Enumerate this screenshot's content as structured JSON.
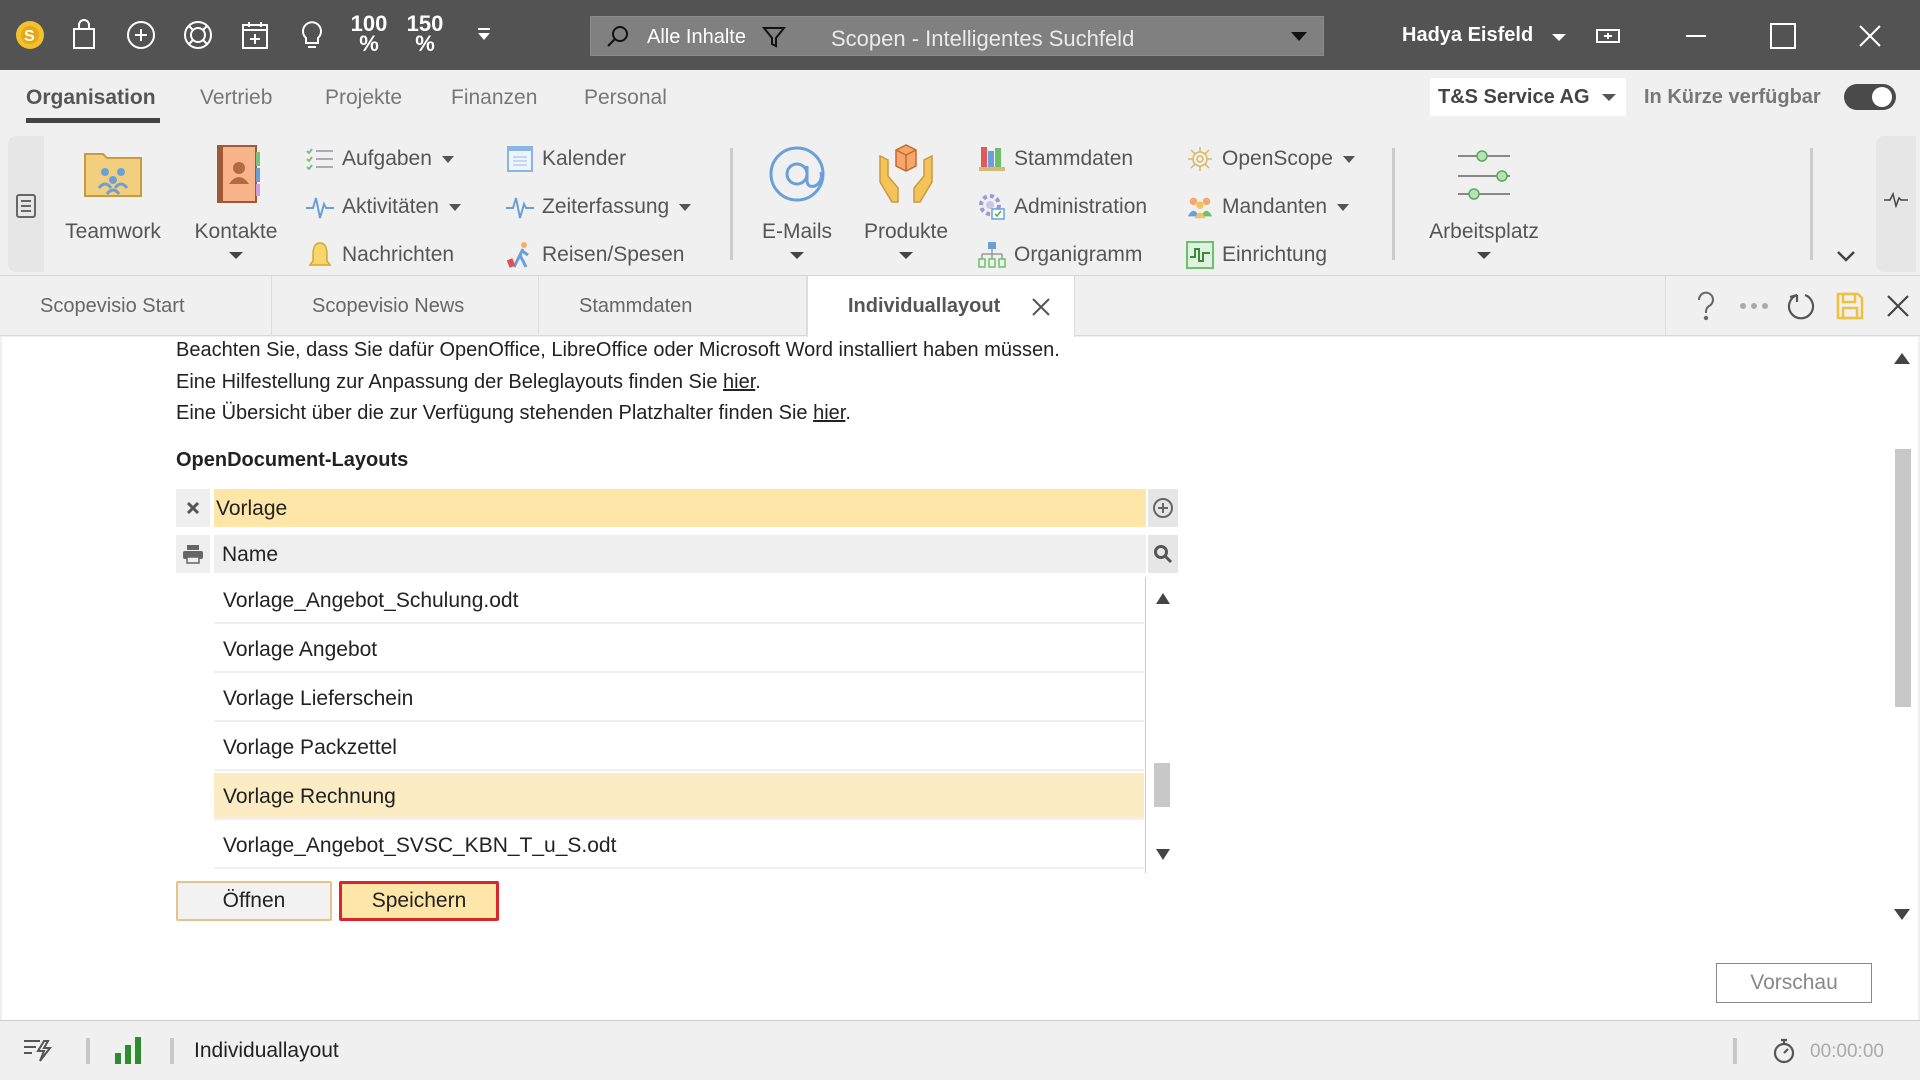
{
  "titlebar": {
    "quick_icons": [
      "scopevisio-logo-icon",
      "shopping-bag-icon",
      "add-circle-icon",
      "lifebuoy-icon",
      "calendar-add-icon",
      "lightbulb-icon"
    ],
    "zoom_100": {
      "top": "100",
      "bottom": "%"
    },
    "zoom_150": {
      "top": "150",
      "bottom": "%"
    },
    "search": {
      "scope": "Alle Inhalte",
      "placeholder": "Scopen - Intelligentes Suchfeld"
    },
    "user_name": "Hadya Eisfeld"
  },
  "ribbon_tabs": {
    "items": [
      {
        "label": "Organisation",
        "active": true
      },
      {
        "label": "Vertrieb",
        "active": false
      },
      {
        "label": "Projekte",
        "active": false
      },
      {
        "label": "Finanzen",
        "active": false
      },
      {
        "label": "Personal",
        "active": false
      }
    ],
    "company": "T&S Service AG",
    "soon_label": "In Kürze verfügbar",
    "soon_toggle_on": true
  },
  "ribbon": {
    "big_buttons": [
      {
        "label": "Teamwork",
        "icon": "teamwork-folder-icon",
        "dropdown": false
      },
      {
        "label": "Kontakte",
        "icon": "contacts-book-icon",
        "dropdown": true
      },
      {
        "label": "E-Mails",
        "icon": "at-sign-icon",
        "dropdown": true
      },
      {
        "label": "Produkte",
        "icon": "product-box-hands-icon",
        "dropdown": true
      },
      {
        "label": "Arbeitsplatz",
        "icon": "sliders-icon",
        "dropdown": true
      }
    ],
    "small_buttons": [
      {
        "label": "Aufgaben",
        "icon": "task-list-icon",
        "dropdown": true
      },
      {
        "label": "Aktivitäten",
        "icon": "activity-pulse-icon",
        "dropdown": true
      },
      {
        "label": "Nachrichten",
        "icon": "bell-icon",
        "dropdown": false
      },
      {
        "label": "Kalender",
        "icon": "calendar-icon",
        "dropdown": false
      },
      {
        "label": "Zeiterfassung",
        "icon": "time-pulse-icon",
        "dropdown": true
      },
      {
        "label": "Reisen/Spesen",
        "icon": "traveler-icon",
        "dropdown": false
      },
      {
        "label": "Stammdaten",
        "icon": "books-icon",
        "dropdown": false
      },
      {
        "label": "Administration",
        "icon": "admin-gear-icon",
        "dropdown": false
      },
      {
        "label": "Organigramm",
        "icon": "org-chart-icon",
        "dropdown": false
      },
      {
        "label": "OpenScope",
        "icon": "openscope-icon",
        "dropdown": true
      },
      {
        "label": "Mandanten",
        "icon": "clients-group-icon",
        "dropdown": true
      },
      {
        "label": "Einrichtung",
        "icon": "setup-signal-icon",
        "dropdown": false
      }
    ]
  },
  "doc_tabs": {
    "items": [
      {
        "label": "Scopevisio Start",
        "active": false
      },
      {
        "label": "Scopevisio News",
        "active": false
      },
      {
        "label": "Stammdaten",
        "active": false
      },
      {
        "label": "Individuallayout",
        "active": true
      }
    ],
    "actions": [
      "help-icon",
      "more-icon",
      "refresh-icon",
      "save-icon",
      "close-icon"
    ],
    "save_color": "#f0c040"
  },
  "content": {
    "info_lines": [
      {
        "text": "Beachten Sie, dass Sie dafür OpenOffice, LibreOffice oder Microsoft Word installiert haben müssen.",
        "link": null
      },
      {
        "text": "Eine Hilfestellung zur Anpassung der Beleglayouts finden Sie ",
        "link": "hier",
        "suffix": "."
      },
      {
        "text": "Eine Übersicht über die zur Verfügung stehenden Platzhalter finden Sie ",
        "link": "hier",
        "suffix": "."
      }
    ],
    "section_title": "OpenDocument-Layouts",
    "filter_value": "Vorlage",
    "column_header": "Name",
    "rows": [
      {
        "name": "Vorlage_Angebot_Schulung.odt",
        "selected": false
      },
      {
        "name": "Vorlage Angebot",
        "selected": false
      },
      {
        "name": "Vorlage Lieferschein",
        "selected": false
      },
      {
        "name": "Vorlage Packzettel",
        "selected": false
      },
      {
        "name": "Vorlage Rechnung",
        "selected": true
      },
      {
        "name": "Vorlage_Angebot_SVSC_KBN_T_u_S.odt",
        "selected": false
      }
    ],
    "buttons": {
      "open": "Öffnen",
      "save": "Speichern",
      "preview": "Vorschau"
    },
    "highlight_color": "#fde6a8",
    "save_outline_color": "#d9262c"
  },
  "statusbar": {
    "label": "Individuallayout",
    "timer": "00:00:00",
    "signal_color": "#2e8b2e"
  }
}
